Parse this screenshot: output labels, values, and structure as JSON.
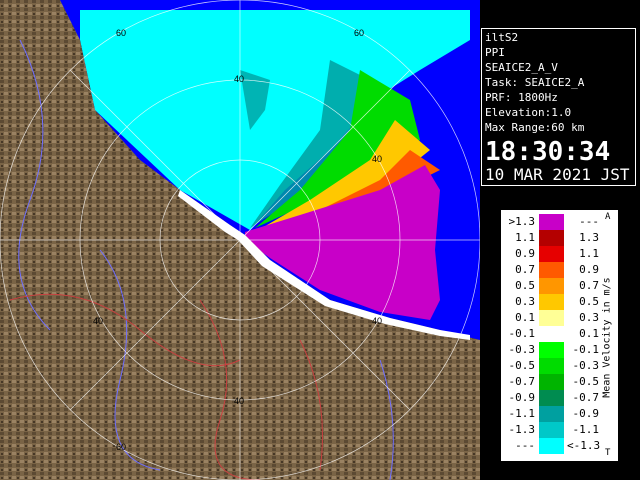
{
  "info": {
    "lines": [
      "iltS2",
      "PPI",
      "SEAICE2_A_V",
      "Task: SEAICE2_A",
      "PRF: 1800Hz",
      "Elevation:1.0",
      "Max Range:60 km"
    ],
    "time": "18:30:34",
    "date": "10 MAR 2021 JST"
  },
  "range_labels": [
    "60",
    "40",
    "60",
    "40",
    "40",
    "40",
    "40",
    "60"
  ],
  "legend": {
    "title": "Mean Velocity in m/s",
    "corner_top": "A",
    "corner_bottom": "T",
    "rows": [
      {
        "lo": ">1.3",
        "hi": "---",
        "color": "#c800c8"
      },
      {
        "lo": "1.1",
        "hi": "1.3",
        "color": "#b40000"
      },
      {
        "lo": "0.9",
        "hi": "1.1",
        "color": "#e60000"
      },
      {
        "lo": "0.7",
        "hi": "0.9",
        "color": "#ff5a00"
      },
      {
        "lo": "0.5",
        "hi": "0.7",
        "color": "#ff9600"
      },
      {
        "lo": "0.3",
        "hi": "0.5",
        "color": "#ffc800"
      },
      {
        "lo": "0.1",
        "hi": "0.3",
        "color": "#ffff96"
      },
      {
        "lo": "-0.1",
        "hi": "0.1",
        "color": "#ffffff"
      },
      {
        "lo": "-0.3",
        "hi": "-0.1",
        "color": "#00ff00"
      },
      {
        "lo": "-0.5",
        "hi": "-0.3",
        "color": "#00dc00"
      },
      {
        "lo": "-0.7",
        "hi": "-0.5",
        "color": "#00b400"
      },
      {
        "lo": "-0.9",
        "hi": "-0.7",
        "color": "#008c50"
      },
      {
        "lo": "-1.1",
        "hi": "-0.9",
        "color": "#00a0a0"
      },
      {
        "lo": "-1.3",
        "hi": "-1.1",
        "color": "#00c8c8"
      },
      {
        "lo": "---",
        "hi": "<-1.3",
        "color": "#00ffff"
      }
    ]
  },
  "colors": {
    "sea": "#0000ff",
    "land": "#7a6446",
    "echo_outbound": "#c800c8",
    "echo_inbound": "#00ffff"
  }
}
